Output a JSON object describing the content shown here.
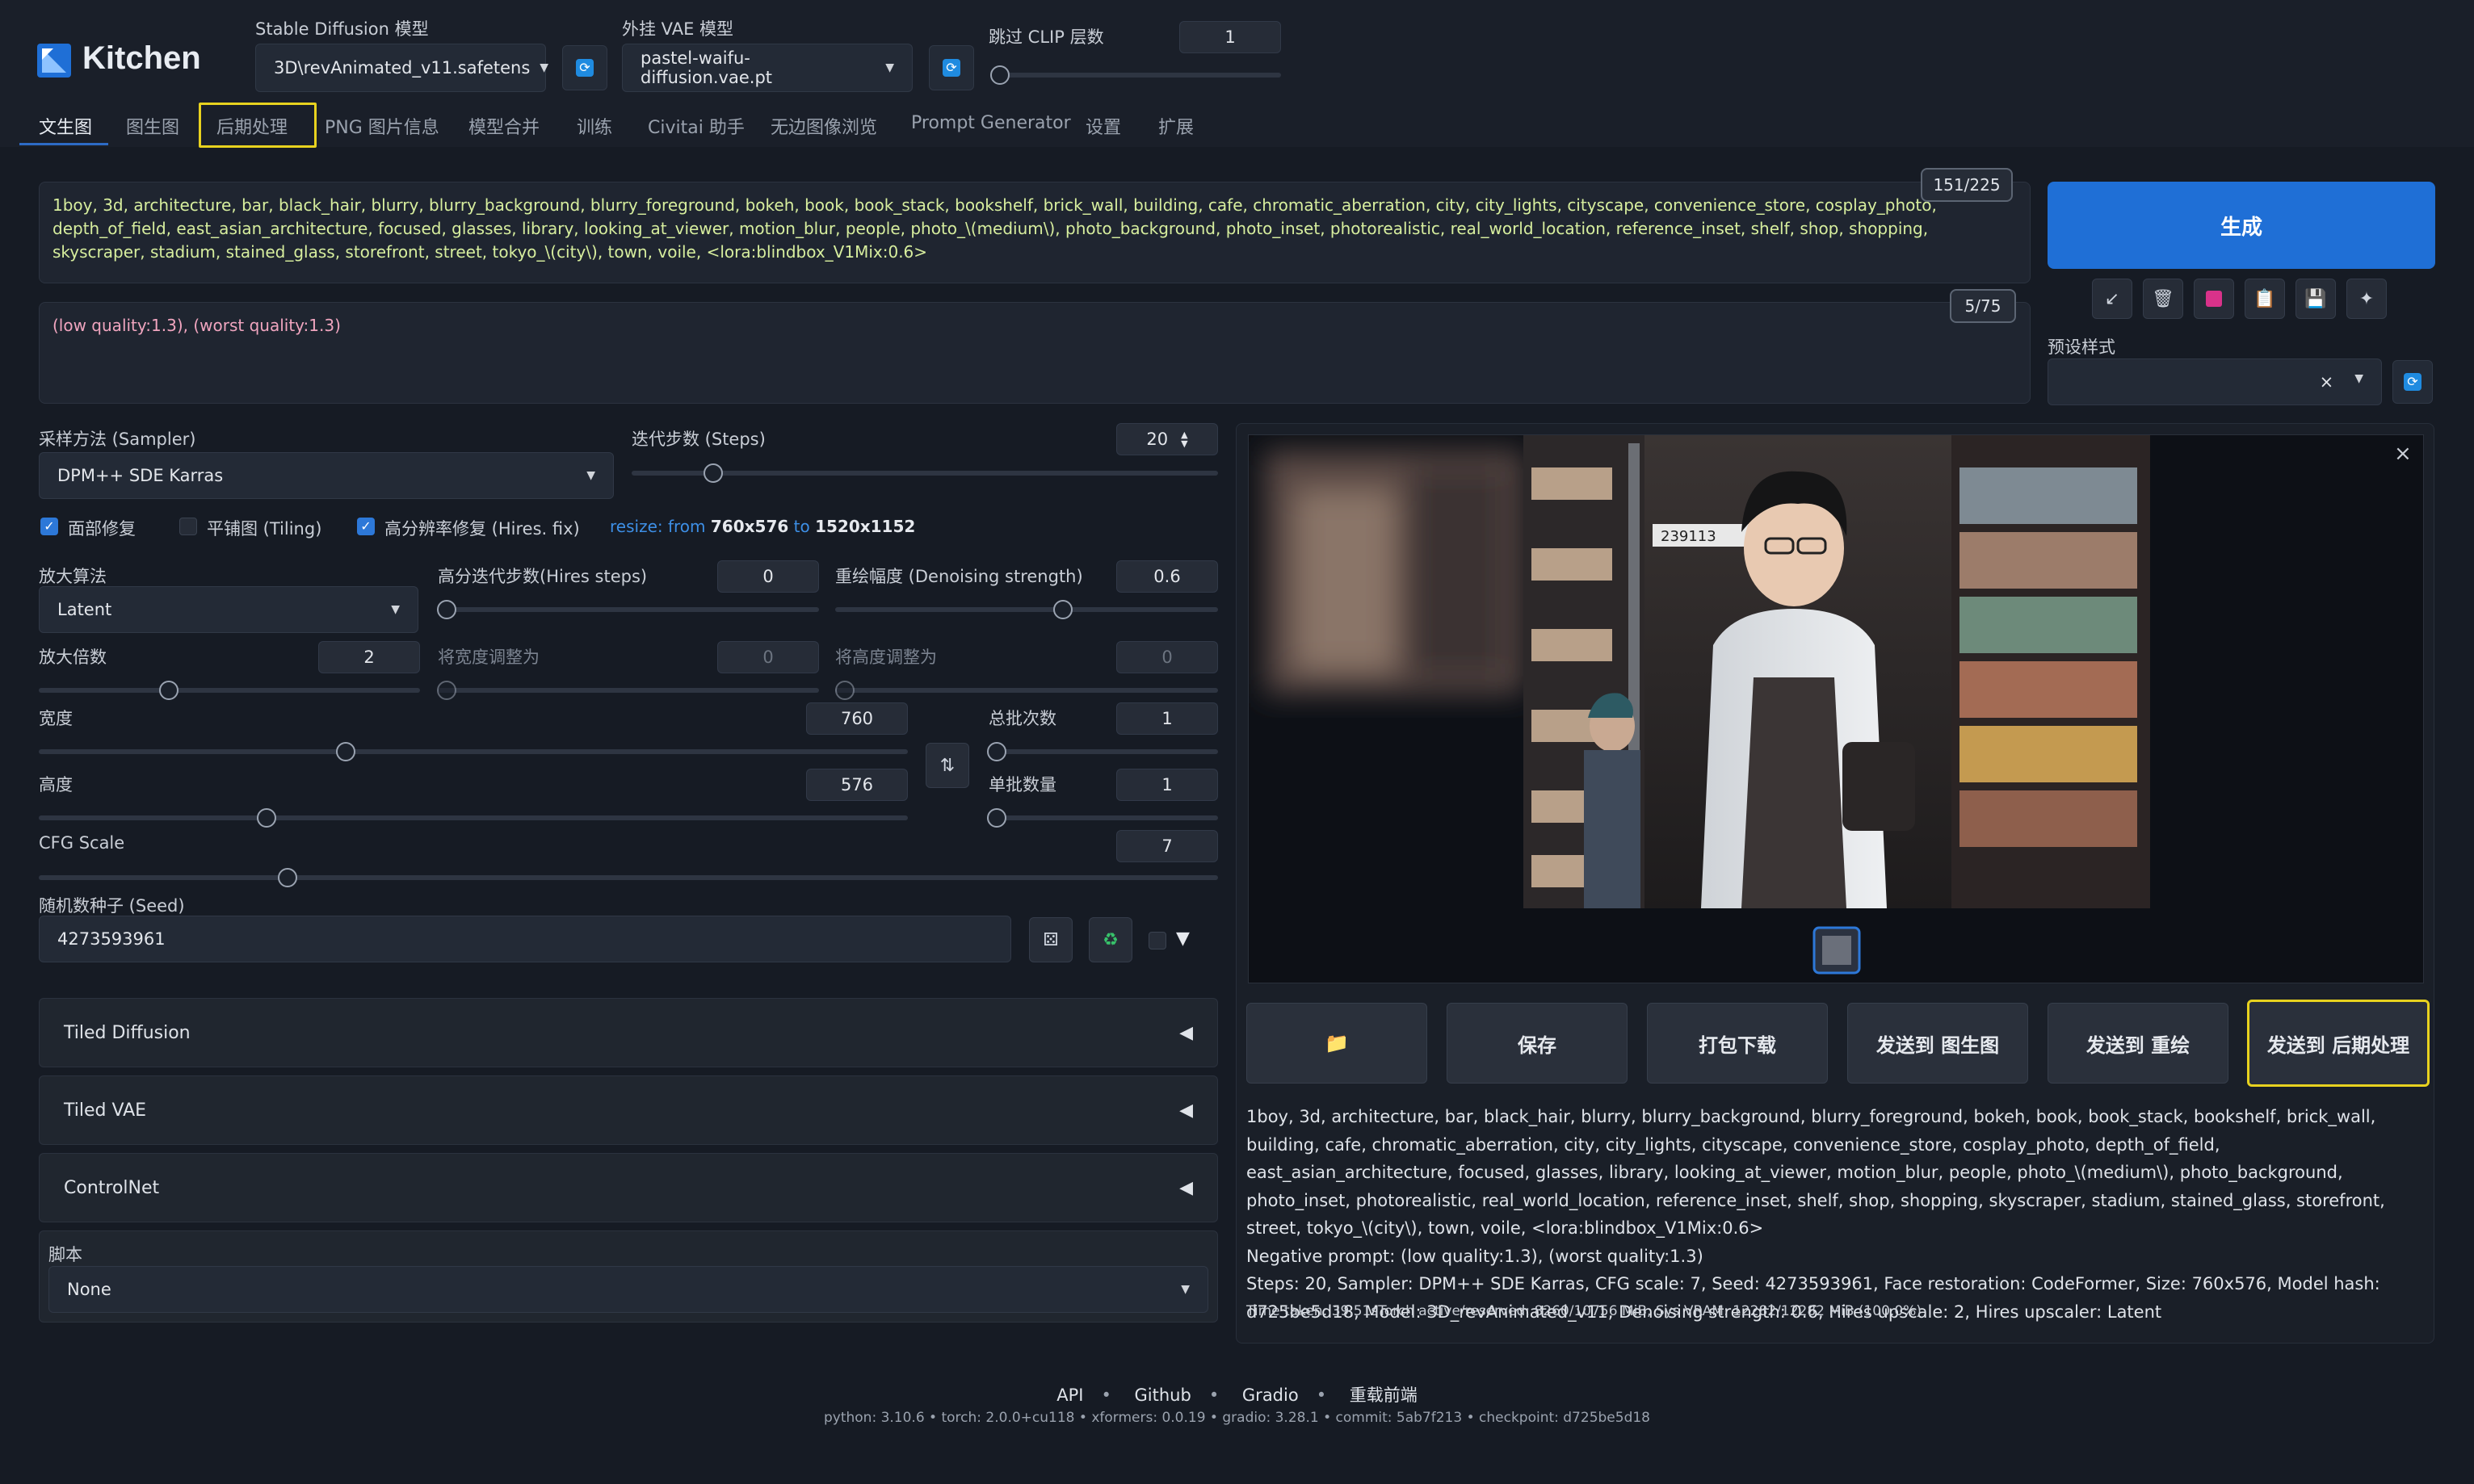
{
  "app": {
    "title": "Kitchen",
    "accent": "#1f6fd6",
    "highlight": "#e8d21f"
  },
  "header": {
    "sd_model_label": "Stable Diffusion 模型",
    "sd_model_value": "3D\\revAnimated_v11.safetens",
    "vae_label": "外挂 VAE 模型",
    "vae_value": "pastel-waifu-diffusion.vae.pt",
    "clip_label": "跳过 CLIP 层数",
    "clip_value": "1",
    "clip_slider_fraction": 0.0
  },
  "tabs": [
    "文生图",
    "图生图",
    "后期处理",
    "PNG 图片信息",
    "模型合并",
    "训练",
    "Civitai 助手",
    "无边图像浏览",
    "Prompt Generator",
    "设置",
    "扩展"
  ],
  "prompt": {
    "positive": "1boy, 3d, architecture, bar, black_hair, blurry, blurry_background, blurry_foreground, bokeh, book, book_stack, bookshelf, brick_wall, building, cafe, chromatic_aberration, city, city_lights, cityscape, convenience_store, cosplay_photo, depth_of_field, east_asian_architecture, focused, glasses, library, looking_at_viewer, motion_blur, people, photo_\\(medium\\), photo_background, photo_inset, photorealistic, real_world_location, reference_inset, shelf, shop, shopping, skyscraper, stadium, stained_glass, storefront, street, tokyo_\\(city\\), town, voile, <lora:blindbox_V1Mix:0.6>",
    "positive_counter": "151/225",
    "negative": "(low quality:1.3), (worst quality:1.3)",
    "negative_counter": "5/75"
  },
  "actions": {
    "generate": "生成",
    "tools": [
      "arrow-icon",
      "trash-icon",
      "image-icon",
      "clipboard-icon",
      "save-icon",
      "magic-icon"
    ],
    "preset_label": "预设样式",
    "preset_clear": "×"
  },
  "params": {
    "sampler_label": "采样方法 (Sampler)",
    "sampler_value": "DPM++ SDE Karras",
    "steps_label": "迭代步数 (Steps)",
    "steps_value": "20",
    "face_restore_label": "面部修复",
    "tiling_label": "平铺图 (Tiling)",
    "hires_label": "高分辨率修复 (Hires. fix)",
    "resize_prefix": "resize: from",
    "resize_from": "760x576",
    "resize_to_word": "to",
    "resize_to": "1520x1152",
    "upscaler_label": "放大算法",
    "upscaler_value": "Latent",
    "hires_steps_label": "高分迭代步数(Hires steps)",
    "hires_steps_value": "0",
    "denoise_label": "重绘幅度 (Denoising strength)",
    "denoise_value": "0.6",
    "upscale_by_label": "放大倍数",
    "upscale_by_value": "2",
    "resize_w_label": "将宽度调整为",
    "resize_w_value": "0",
    "resize_h_label": "将高度调整为",
    "resize_h_value": "0",
    "width_label": "宽度",
    "width_value": "760",
    "height_label": "高度",
    "height_value": "576",
    "batch_count_label": "总批次数",
    "batch_count_value": "1",
    "batch_size_label": "单批数量",
    "batch_size_value": "1",
    "cfg_label": "CFG Scale",
    "cfg_value": "7",
    "seed_label": "随机数种子 (Seed)",
    "seed_value": "4273593961"
  },
  "accordions": [
    "Tiled Diffusion",
    "Tiled VAE",
    "ControlNet"
  ],
  "script": {
    "label": "脚本",
    "value": "None"
  },
  "output": {
    "buttons": [
      "保存",
      "打包下载",
      "发送到 图生图",
      "发送到 重绘",
      "发送到 后期处理"
    ],
    "info_prompt": "1boy, 3d, architecture, bar, black_hair, blurry, blurry_background, blurry_foreground, bokeh, book, book_stack, bookshelf, brick_wall, building, cafe, chromatic_aberration, city, city_lights, cityscape, convenience_store, cosplay_photo, depth_of_field, east_asian_architecture, focused, glasses, library, looking_at_viewer, motion_blur, people, photo_\\(medium\\), photo_background, photo_inset, photorealistic, real_world_location, reference_inset, shelf, shop, shopping, skyscraper, stadium, stained_glass, storefront, street, tokyo_\\(city\\), town, voile, <lora:blindbox_V1Mix:0.6>",
    "info_negative": "Negative prompt: (low quality:1.3), (worst quality:1.3)",
    "info_params": "Steps: 20, Sampler: DPM++ SDE Karras, CFG scale: 7, Seed: 4273593961, Face restoration: CodeFormer, Size: 760x576, Model hash: d725be5d18, Model: 3D_revAnimated_v11, Denoising strength: 0.6, Hires upscale: 2, Hires upscaler: Latent",
    "time_taken": "Time taken: 39.51sTorch active/reserved: 8260/10756 MiB, Sys VRAM: 12282/12282 MiB (100.0%)",
    "image_text": "239113"
  },
  "footer": {
    "links": [
      "API",
      "Github",
      "Gradio",
      "重载前端"
    ],
    "meta": "python: 3.10.6  •  torch: 2.0.0+cu118  •  xformers: 0.0.19  •  gradio: 3.28.1  •  commit: 5ab7f213  •  checkpoint: d725be5d18"
  }
}
